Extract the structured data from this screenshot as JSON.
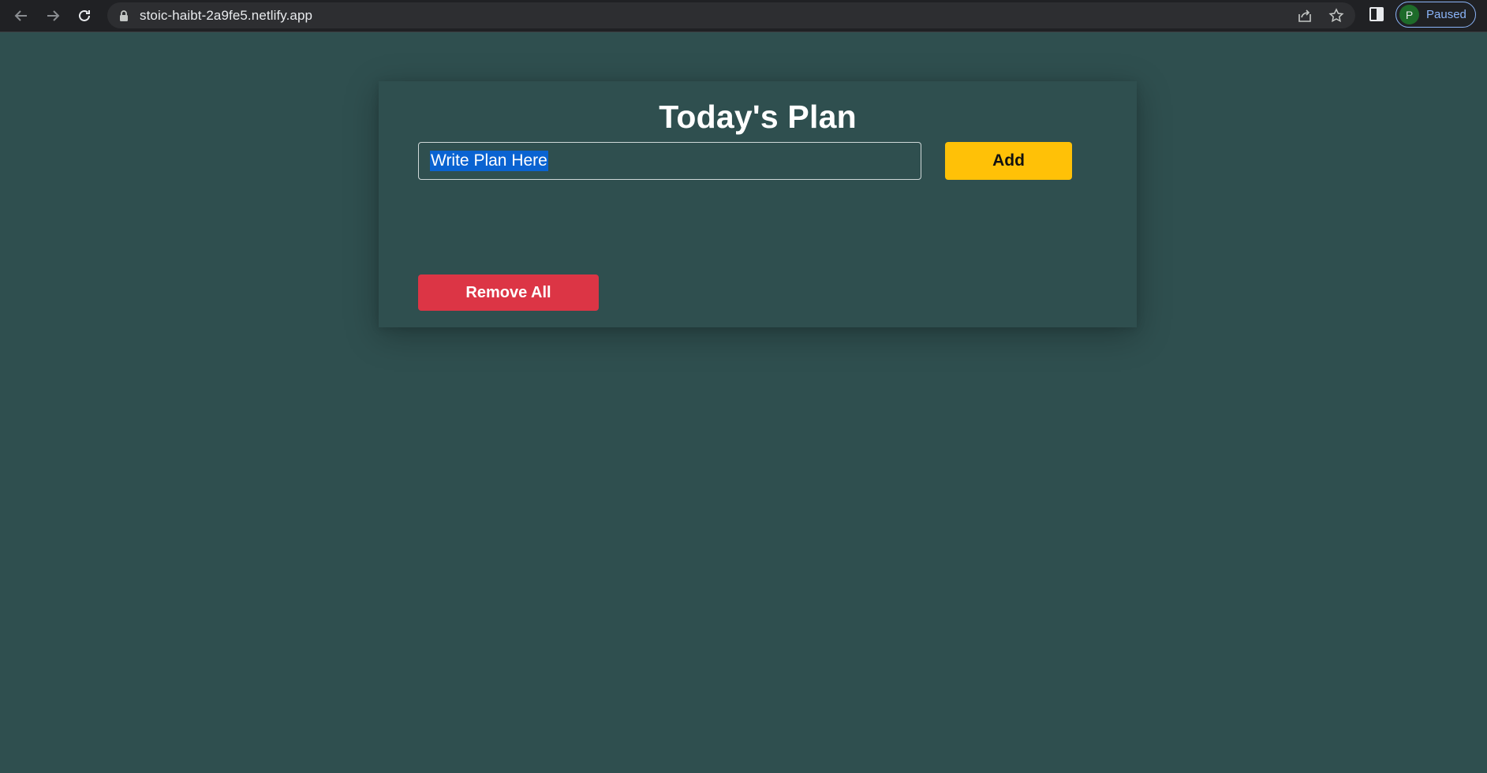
{
  "browser": {
    "url": "stoic-haibt-2a9fe5.netlify.app",
    "profile_initial": "P",
    "profile_status": "Paused",
    "icons": [
      "back-arrow-icon",
      "forward-arrow-icon",
      "reload-icon",
      "lock-icon",
      "share-icon",
      "star-icon",
      "side-panel-icon"
    ]
  },
  "page": {
    "title": "Today's Plan",
    "input_value": "Write Plan Here",
    "add_label": "Add",
    "remove_all_label": "Remove All"
  },
  "colors": {
    "background": "#2f4f4f",
    "add_button": "#ffc107",
    "remove_button": "#dc3545",
    "selection": "#0a63d1"
  }
}
